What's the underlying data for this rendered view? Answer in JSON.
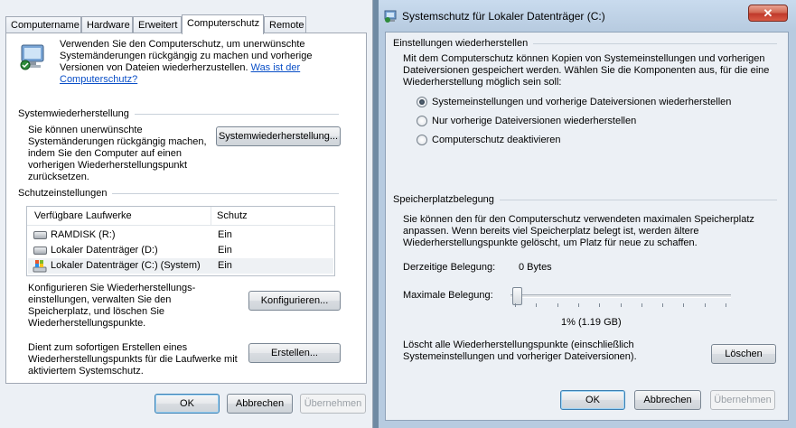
{
  "left_dialog": {
    "tabs": [
      {
        "label": "Computername"
      },
      {
        "label": "Hardware"
      },
      {
        "label": "Erweitert"
      },
      {
        "label": "Computerschutz"
      },
      {
        "label": "Remote"
      }
    ],
    "active_tab": "Computerschutz",
    "intro_text": "Verwenden Sie den Computerschutz, um unerwünschte Systemänderungen rückgängig zu machen und vorherige Versionen von Dateien wiederherzustellen.",
    "intro_link": "Was ist der Computerschutz?",
    "restore_section": {
      "title": "Systemwiederherstellung",
      "description": "Sie können unerwünschte Systemänderungen rückgängig machen, indem Sie den Computer auf einen vorherigen Wiederherstellungspunkt zurücksetzen.",
      "button": "Systemwiederherstellung..."
    },
    "protection_section": {
      "title": "Schutzeinstellungen",
      "columns": [
        "Verfügbare Laufwerke",
        "Schutz"
      ],
      "drives": [
        {
          "name": "RAMDISK (R:)",
          "protection": "Ein"
        },
        {
          "name": "Lokaler Datenträger (D:)",
          "protection": "Ein"
        },
        {
          "name": "Lokaler Datenträger (C:) (System)",
          "protection": "Ein"
        }
      ],
      "configure_text": "Konfigurieren Sie Wiederherstellungs-einstellungen, verwalten Sie den Speicherplatz, und löschen Sie Wiederherstellungspunkte.",
      "configure_button": "Konfigurieren...",
      "create_text": "Dient zum sofortigen Erstellen eines Wiederherstellungspunkts für die Laufwerke mit aktiviertem Systemschutz.",
      "create_button": "Erstellen..."
    },
    "buttons": {
      "ok": "OK",
      "cancel": "Abbrechen",
      "apply": "Übernehmen"
    }
  },
  "right_dialog": {
    "title": "Systemschutz für Lokaler Datenträger (C:)",
    "close_label": "✕",
    "restore_settings": {
      "title": "Einstellungen wiederherstellen",
      "description": "Mit dem Computerschutz können Kopien von Systemeinstellungen und vorherigen Dateiversionen gespeichert werden. Wählen Sie die Komponenten aus, für die eine Wiederherstellung möglich sein soll:",
      "options": [
        {
          "label": "Systemeinstellungen und vorherige Dateiversionen wiederherstellen",
          "selected": true
        },
        {
          "label": "Nur vorherige Dateiversionen wiederherstellen",
          "selected": false
        },
        {
          "label": "Computerschutz deaktivieren",
          "selected": false
        }
      ]
    },
    "disk_usage": {
      "title": "Speicherplatzbelegung",
      "description": "Sie können den für den Computerschutz verwendeten maximalen Speicherplatz anpassen. Wenn bereits viel Speicherplatz belegt ist, werden ältere Wiederherstellungspunkte gelöscht, um Platz für neue zu schaffen.",
      "current_label": "Derzeitige Belegung:",
      "current_value": "0 Bytes",
      "max_label": "Maximale Belegung:",
      "max_value_text": "1% (1.19 GB)",
      "max_percent": 1,
      "delete_text": "Löscht alle Wiederherstellungspunkte (einschließlich Systemeinstellungen und vorheriger Dateiversionen).",
      "delete_button": "Löschen"
    },
    "buttons": {
      "ok": "OK",
      "cancel": "Abbrechen",
      "apply": "Übernehmen"
    }
  },
  "colors": {
    "link": "#0a4fc7",
    "titlebar": "#b7cbe0",
    "close": "#c0392b"
  }
}
